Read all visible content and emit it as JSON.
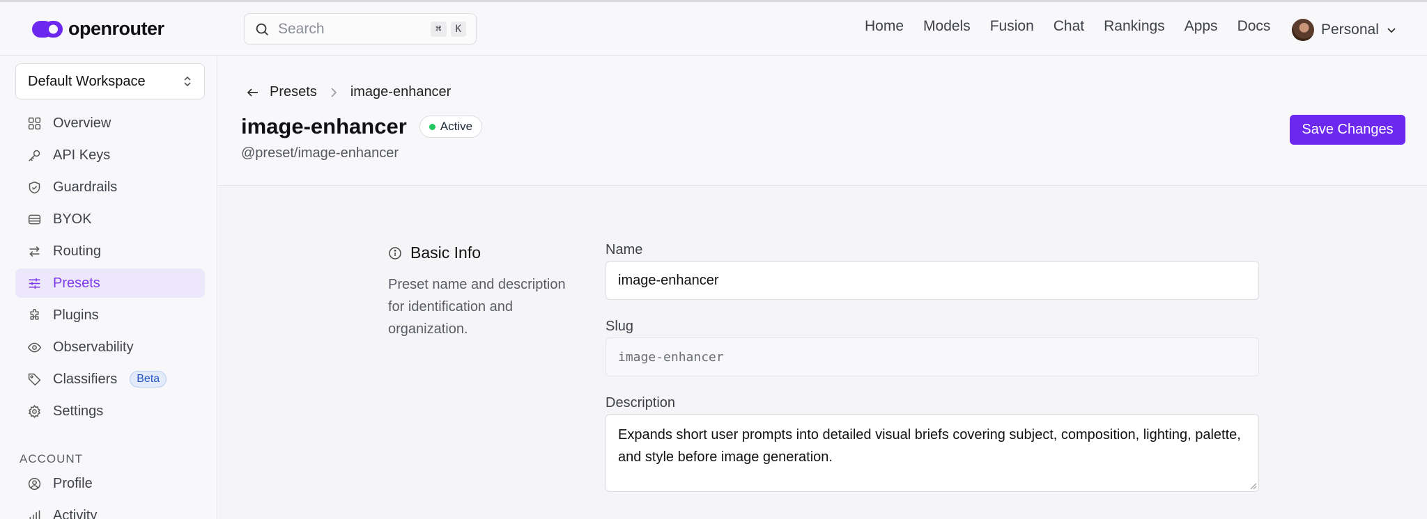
{
  "header": {
    "logo_text": "openrouter",
    "search_placeholder": "Search",
    "search_shortcut": [
      "⌘",
      "K"
    ],
    "nav": [
      "Home",
      "Models",
      "Fusion",
      "Chat",
      "Rankings",
      "Apps",
      "Docs"
    ],
    "account_label": "Personal"
  },
  "sidebar": {
    "workspace": "Default Workspace",
    "items": [
      {
        "label": "Overview",
        "icon": "grid-icon"
      },
      {
        "label": "API Keys",
        "icon": "key-icon"
      },
      {
        "label": "Guardrails",
        "icon": "shield-icon"
      },
      {
        "label": "BYOK",
        "icon": "database-icon"
      },
      {
        "label": "Routing",
        "icon": "arrows-icon"
      },
      {
        "label": "Presets",
        "icon": "sliders-icon",
        "active": true
      },
      {
        "label": "Plugins",
        "icon": "puzzle-icon"
      },
      {
        "label": "Observability",
        "icon": "eye-icon"
      },
      {
        "label": "Classifiers",
        "icon": "tag-icon",
        "badge": "Beta"
      },
      {
        "label": "Settings",
        "icon": "gear-icon"
      }
    ],
    "account_section": "ACCOUNT",
    "account_items": [
      {
        "label": "Profile",
        "icon": "user-circle-icon"
      },
      {
        "label": "Activity",
        "icon": "bar-chart-icon"
      }
    ]
  },
  "page": {
    "breadcrumb_parent": "Presets",
    "breadcrumb_current": "image-enhancer",
    "title": "image-enhancer",
    "status": "Active",
    "slug_ref": "@preset/image-enhancer",
    "save_label": "Save Changes"
  },
  "form": {
    "section_title": "Basic Info",
    "section_desc": "Preset name and description for identification and organization.",
    "name_label": "Name",
    "name_value": "image-enhancer",
    "slug_label": "Slug",
    "slug_value": "image-enhancer",
    "description_label": "Description",
    "description_value": "Expands short user prompts into detailed visual briefs covering subject, composition, lighting, palette, and style before image generation."
  },
  "colors": {
    "accent": "#6d28f0",
    "active_bg": "#ece7fb",
    "status_green": "#22c55e"
  }
}
